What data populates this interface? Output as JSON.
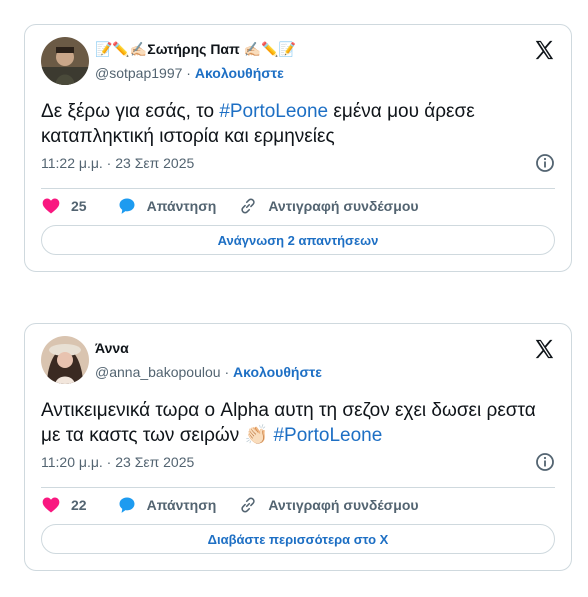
{
  "tweets": [
    {
      "display_name": "📝✏️✍🏻Σωτήρης Παπ ✍🏻✏️📝",
      "handle": "@sotpap1997",
      "separator": "·",
      "follow_label": "Ακολουθήστε",
      "text_before": "Δε ξέρω για εσάς, το ",
      "hashtag": "#PortoLeone",
      "text_after": " εμένα μου άρεσε καταπληκτική ιστορία και ερμηνείες",
      "timestamp": "11:22 μ.μ. · 23 Σεπ 2025",
      "likes": "25",
      "reply_label": "Απάντηση",
      "copy_link_label": "Αντιγραφή συνδέσμου",
      "footer_button": "Ανάγνωση 2 απαντήσεων"
    },
    {
      "display_name": "Άννα",
      "handle": "@anna_bakopoulou",
      "separator": "·",
      "follow_label": "Ακολουθήστε",
      "text_before": "Αντικειμενικά τωρα ο Alpha αυτη τη σεζον εχει δωσει ρεστα με τα καστς των σειρών 👏🏻 ",
      "hashtag": "#PortoLeone",
      "text_after": "",
      "timestamp": "11:20 μ.μ. · 23 Σεπ 2025",
      "likes": "22",
      "reply_label": "Απάντηση",
      "copy_link_label": "Αντιγραφή συνδέσμου",
      "footer_button": "Διαβάστε περισσότερα στο X"
    }
  ],
  "icons": {
    "brand": "x-logo-icon",
    "info": "info-icon",
    "like": "heart-icon",
    "reply": "speech-bubble-icon",
    "copy": "link-icon"
  },
  "colors": {
    "link": "#1d6fc4",
    "heart": "#f91880",
    "reply": "#1d9bf0",
    "secondary_text": "#536471",
    "border": "#cfd9de"
  }
}
